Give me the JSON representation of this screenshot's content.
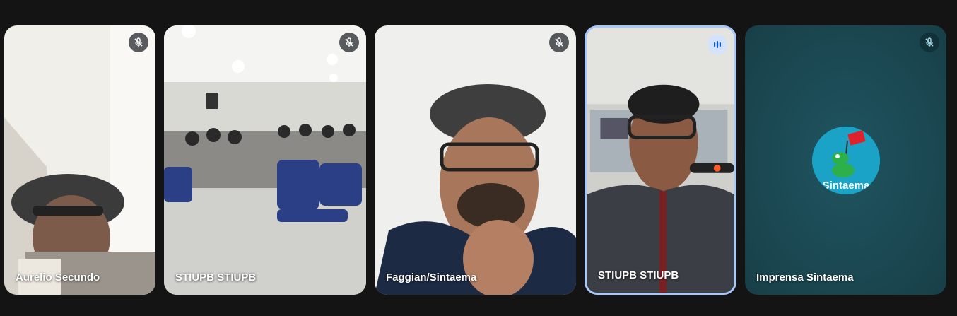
{
  "participants": [
    {
      "name": "Aurelio Secundo",
      "mic": "muted-mic-icon"
    },
    {
      "name": "STIUPB STIUPB",
      "mic": "muted-mic-icon"
    },
    {
      "name": "Faggian/Sintaema",
      "mic": "muted-mic-icon"
    },
    {
      "name": "STIUPB STIUPB",
      "mic": "speaking-indicator-icon",
      "active": true
    },
    {
      "name": "Imprensa Sintaema",
      "mic": "muted-mic-icon",
      "avatar_text": "Sintaema"
    }
  ],
  "colors": {
    "background": "#141414",
    "active_border": "#a8c7fa",
    "avatar_bg": "#1aa3c7",
    "tile_teal": "#1f4f5a"
  }
}
